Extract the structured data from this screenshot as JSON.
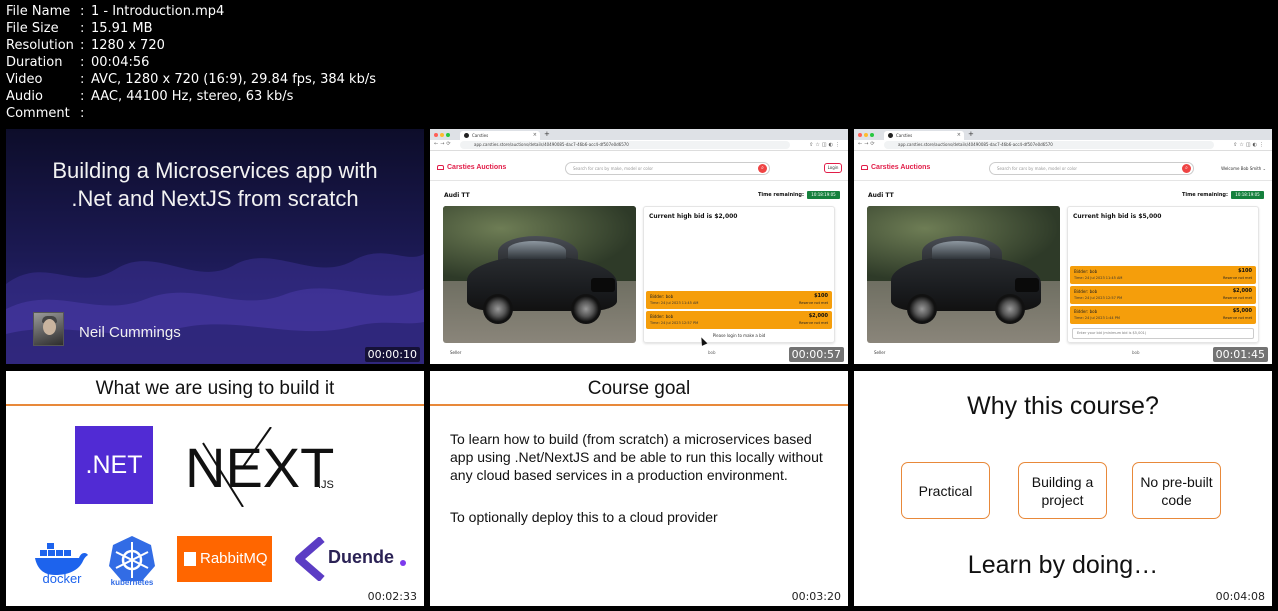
{
  "meta": {
    "rows": [
      {
        "label": "File Name",
        "value": "1 - Introduction.mp4"
      },
      {
        "label": "File Size",
        "value": "15.91 MB"
      },
      {
        "label": "Resolution",
        "value": "1280 x 720"
      },
      {
        "label": "Duration",
        "value": "00:04:56"
      },
      {
        "label": "Video",
        "value": "AVC, 1280 x 720 (16:9), 29.84 fps, 384 kb/s"
      },
      {
        "label": "Audio",
        "value": "AAC, 44100 Hz, stereo, 63 kb/s"
      },
      {
        "label": "Comment",
        "value": ""
      }
    ]
  },
  "thumbs": [
    {
      "timestamp": "00:00:10",
      "title_line1": "Building a Microservices app with",
      "title_line2": ".Net and NextJS from scratch",
      "presenter": "Neil Cummings"
    },
    {
      "timestamp": "00:00:57",
      "tab_title": "Carsties",
      "url": "app.carsties.store/auctions/details/40490085-dac7-46b6-acc4-df507e0d6570",
      "site_name": "Carsties Auctions",
      "search_placeholder": "Search for cars by make, model or color",
      "nav_right": "Login",
      "car_title": "Audi TT",
      "time_label": "Time remaining:",
      "time_value": "10:18:19:05",
      "high_bid": "Current high bid is $2,000",
      "bids": [
        {
          "bidder": "Bidder: bob",
          "time": "Time: 24 Jul 2023 11:45 AM",
          "amount": "$100",
          "reserve": "Reserve not met"
        },
        {
          "bidder": "Bidder: bob",
          "time": "Time: 24 Jul 2023 12:57 PM",
          "amount": "$2,000",
          "reserve": "Reserve not met"
        }
      ],
      "footer_message": "Please login to make a bid",
      "seller_label": "Seller",
      "seller_value": "bob"
    },
    {
      "timestamp": "00:01:45",
      "tab_title": "Carsties",
      "url": "app.carsties.store/auctions/details/40490085-dac7-46b6-acc4-df507e0d6570",
      "site_name": "Carsties Auctions",
      "search_placeholder": "Search for cars by make, model or color",
      "nav_right": "Welcome Bob Smith",
      "car_title": "Audi TT",
      "time_label": "Time remaining:",
      "time_value": "10:18:19:05",
      "high_bid": "Current high bid is $5,000",
      "bids": [
        {
          "bidder": "Bidder: bob",
          "time": "Time: 24 Jul 2023 11:45 AM",
          "amount": "$100",
          "reserve": "Reserve not met"
        },
        {
          "bidder": "Bidder: bob",
          "time": "Time: 24 Jul 2023 12:57 PM",
          "amount": "$2,000",
          "reserve": "Reserve not met"
        },
        {
          "bidder": "Bidder: bob",
          "time": "Time: 24 Jul 2023 1:44 PM",
          "amount": "$5,000",
          "reserve": "Reserve not met"
        }
      ],
      "bid_input_placeholder": "Enter your bid (minimum bid is $5,001)",
      "seller_label": "Seller",
      "seller_value": "bob"
    },
    {
      "timestamp": "00:02:33",
      "slide_title": "What we are using to build it",
      "net_label": ".NET",
      "next_label": "NEXT",
      "next_suffix": ".JS",
      "docker_label": "docker",
      "k8s_label": "kubernetes",
      "rabbit_label": "RabbitMQ",
      "duende_label": "Duende"
    },
    {
      "timestamp": "00:03:20",
      "slide_title": "Course goal",
      "paragraph1": "To learn how to build (from scratch) a microservices based app using .Net/NextJS and be able to run this locally without any cloud based services in a production environment.",
      "paragraph2": "To optionally deploy this to a cloud provider"
    },
    {
      "timestamp": "00:04:08",
      "slide_title": "Why this course?",
      "boxes": [
        "Practical",
        "Building a project",
        "No pre-built code"
      ],
      "tagline": "Learn by doing…"
    }
  ],
  "colors": {
    "accent_orange": "#e8893a",
    "bid_orange": "#f59e0b",
    "brand_red": "#e11d48",
    "net_purple": "#512bd4",
    "timer_green": "#15803d"
  }
}
